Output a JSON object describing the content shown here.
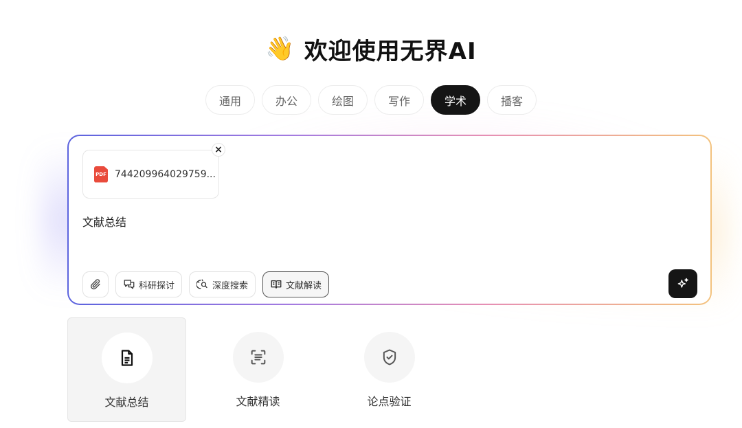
{
  "header": {
    "wave_emoji": "👋",
    "title": "欢迎使用无界AI"
  },
  "tabs": [
    {
      "label": "通用",
      "active": false
    },
    {
      "label": "办公",
      "active": false
    },
    {
      "label": "绘图",
      "active": false
    },
    {
      "label": "写作",
      "active": false
    },
    {
      "label": "学术",
      "active": true
    },
    {
      "label": "播客",
      "active": false
    }
  ],
  "composer": {
    "attachment": {
      "icon": "pdf-icon",
      "icon_text": "PDF",
      "file_name": "744209964029759...",
      "close_glyph": "×"
    },
    "prompt_value": "文献总结",
    "toolbar": {
      "attach_icon": "paperclip-icon",
      "research_label": "科研探讨",
      "deep_search_label": "深度搜索",
      "literature_label": "文献解读"
    },
    "send_icon": "sparkle-icon"
  },
  "cards": [
    {
      "label": "文献总结",
      "icon": "document-icon",
      "selected": true
    },
    {
      "label": "文献精读",
      "icon": "scan-text-icon",
      "selected": false
    },
    {
      "label": "论点验证",
      "icon": "shield-check-icon",
      "selected": false
    }
  ],
  "colors": {
    "active_tab_bg": "#151515",
    "gradient_start": "#5b63de",
    "gradient_end": "#f3c27d",
    "pdf_red": "#e94b3c"
  }
}
